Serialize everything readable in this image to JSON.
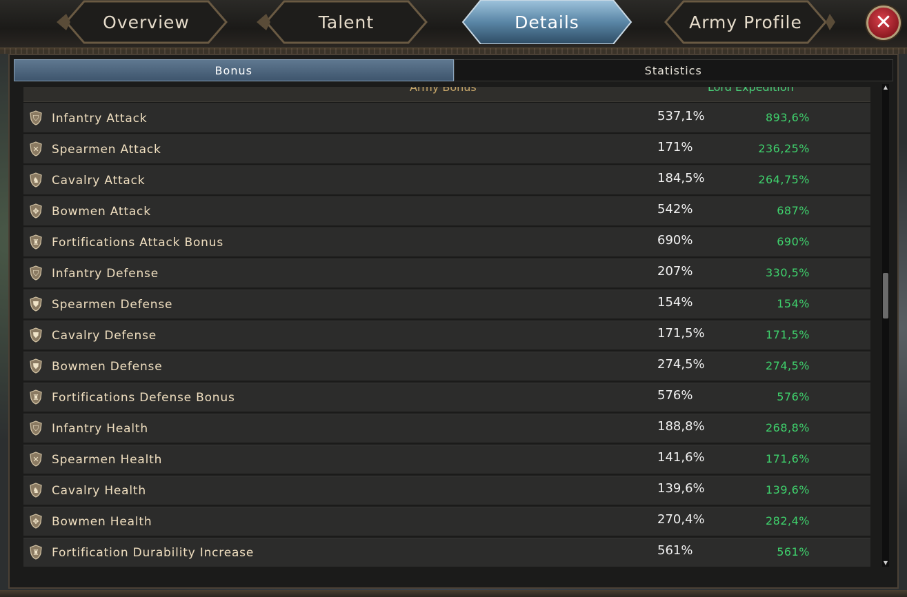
{
  "tabs": [
    {
      "label": "Overview",
      "active": false
    },
    {
      "label": "Talent",
      "active": false
    },
    {
      "label": "Details",
      "active": true
    },
    {
      "label": "Army Profile",
      "active": false
    }
  ],
  "close_label": "✕",
  "subtabs": [
    {
      "label": "Bonus",
      "active": true
    },
    {
      "label": "Statistics",
      "active": false
    }
  ],
  "columns": {
    "army_bonus": "Army Bonus",
    "lord_expedition": "Lord Expedition"
  },
  "rows": [
    {
      "icon": "shield-icon",
      "label": "Infantry Attack",
      "value": "537,1%",
      "expedition": "893,6%"
    },
    {
      "icon": "crossed-spears-icon",
      "label": "Spearmen Attack",
      "value": "171%",
      "expedition": "236,25%"
    },
    {
      "icon": "horse-head-icon",
      "label": "Cavalry Attack",
      "value": "184,5%",
      "expedition": "264,75%"
    },
    {
      "icon": "crossbow-icon",
      "label": "Bowmen Attack",
      "value": "542%",
      "expedition": "687%"
    },
    {
      "icon": "tower-icon",
      "label": "Fortifications Attack Bonus",
      "value": "690%",
      "expedition": "690%"
    },
    {
      "icon": "shield-icon",
      "label": "Infantry Defense",
      "value": "207%",
      "expedition": "330,5%"
    },
    {
      "icon": "spear-shield-icon",
      "label": "Spearmen Defense",
      "value": "154%",
      "expedition": "154%"
    },
    {
      "icon": "horse-shield-icon",
      "label": "Cavalry Defense",
      "value": "171,5%",
      "expedition": "171,5%"
    },
    {
      "icon": "bow-shield-icon",
      "label": "Bowmen Defense",
      "value": "274,5%",
      "expedition": "274,5%"
    },
    {
      "icon": "castle-icon",
      "label": "Fortifications Defense Bonus",
      "value": "576%",
      "expedition": "576%"
    },
    {
      "icon": "helmet-shield-icon",
      "label": "Infantry Health",
      "value": "188,8%",
      "expedition": "268,8%"
    },
    {
      "icon": "crossed-spears-icon",
      "label": "Spearmen Health",
      "value": "141,6%",
      "expedition": "171,6%"
    },
    {
      "icon": "horse-head-icon",
      "label": "Cavalry Health",
      "value": "139,6%",
      "expedition": "139,6%"
    },
    {
      "icon": "crossbow-icon",
      "label": "Bowmen Health",
      "value": "270,4%",
      "expedition": "282,4%"
    },
    {
      "icon": "castle-icon",
      "label": "Fortification Durability Increase",
      "value": "561%",
      "expedition": "561%"
    }
  ]
}
